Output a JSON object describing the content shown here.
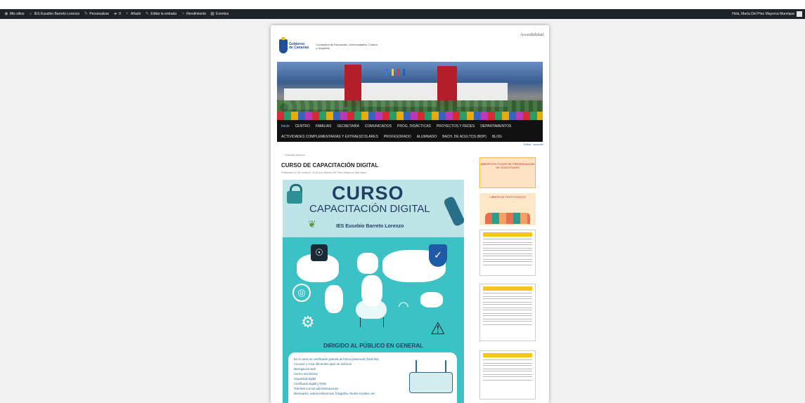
{
  "admin_bar": {
    "items": [
      {
        "icon": "wordpress-icon",
        "label": "Mis sitios"
      },
      {
        "icon": "home-icon",
        "label": "IES Eusebio Barreto Lorenzo"
      },
      {
        "icon": "brush-icon",
        "label": "Personalizar"
      },
      {
        "icon": "comment-icon",
        "label": "0"
      },
      {
        "icon": "plus-icon",
        "label": "Añadir"
      },
      {
        "icon": "pencil-icon",
        "label": "Editar la entrada"
      },
      {
        "icon": "gauge-icon",
        "label": "Rendimiento"
      },
      {
        "icon": "calendar-icon",
        "label": "Eventos"
      }
    ],
    "greeting": "Hola, María Del Pino Mayorca Manrique"
  },
  "header": {
    "accessibility": "Accesibilidad",
    "logo_line1": "Gobierno",
    "logo_line2": "de Canarias",
    "department": "Consejería de Educación, Universidades, Cultura y Deportes"
  },
  "nav": {
    "row1": [
      "Inicio",
      "CENTRO",
      "FAMILIAS",
      "SECRETARÍA",
      "COMUNICADOS",
      "PROG. DIDÁCTICAS",
      "PROYECTOS Y REDES",
      "DEPARTAMENTOS"
    ],
    "row2": [
      "ACTIVIDADES COMPLEMENTARIAS Y EXTRAESCOLARES",
      "PROFESORADO",
      "ALUMNADO",
      "BACH. DE ADULTOS (BDP)",
      "BLOG"
    ]
  },
  "login_links": "Editor · acceder",
  "post": {
    "prev_link": "← Entrada anterior",
    "title": "CURSO DE CAPACITACIÓN DIGITAL",
    "meta": "Publicado el 28 octubre, 2022 por María Del Pino Mayorca Manrique"
  },
  "poster": {
    "curso": "CURSO",
    "capacitacion": "CAPACITACIÓN DIGITAL",
    "school": "IES Eusebio Barreto Lorenzo",
    "dirigido": "DIRIGIDO AL PÚBLICO EN GENERAL",
    "topics": [
      "En el curso se certificarán gratuita de forma presencial (Nivel Bs)",
      "Conocer y crear diferentes tipos de archivos",
      "Navegación web",
      "Correo electrónico",
      "Seguridad digital",
      "Certificado digital y DNIe",
      "Trámites con las administraciones",
      "Mensajería, videoconferencias, fotografía, Redes sociales, etc."
    ]
  },
  "sidebar": {
    "thumb1": "ABIERTO EL PLAZO DE PRESENTACIÓN DE SOLICITUDES",
    "thumb2": "LIBROS DE TEXTO 2022/23"
  }
}
